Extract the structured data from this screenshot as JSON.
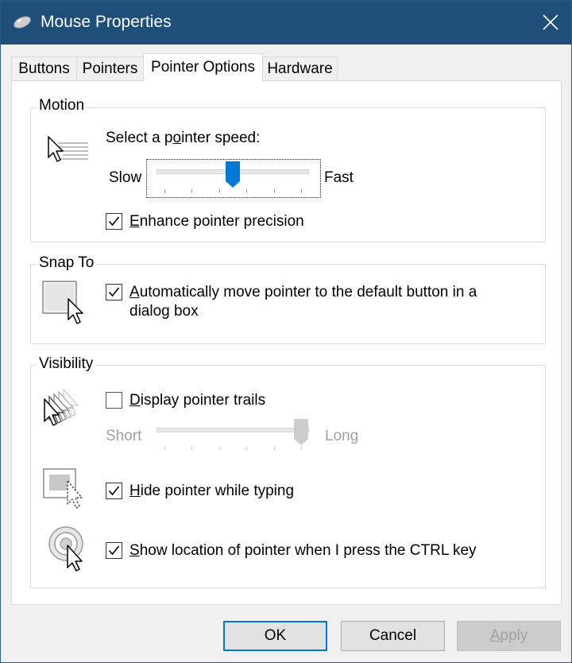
{
  "window": {
    "title": "Mouse Properties"
  },
  "tabs": [
    "Buttons",
    "Pointers",
    "Pointer Options",
    "Hardware"
  ],
  "active_tab_index": 2,
  "motion": {
    "group_label": "Motion",
    "speed_prompt": "Select a pointer speed:",
    "slow_label": "Slow",
    "fast_label": "Fast",
    "speed_value": 0.5,
    "enhance_precision": {
      "label": "Enhance pointer precision",
      "checked": true
    }
  },
  "snap_to": {
    "group_label": "Snap To",
    "auto_move": {
      "line1": "Automatically move pointer to the default button in a",
      "line2": "dialog box",
      "checked": true
    }
  },
  "visibility": {
    "group_label": "Visibility",
    "trails": {
      "label": "Display pointer trails",
      "checked": false,
      "short_label": "Short",
      "long_label": "Long",
      "trail_value": 1.0,
      "enabled": false
    },
    "hide_typing": {
      "label": "Hide pointer while typing",
      "checked": true
    },
    "show_location": {
      "label": "Show location of pointer when I press the CTRL key",
      "checked": true
    }
  },
  "buttons": {
    "ok": "OK",
    "cancel": "Cancel",
    "apply": "Apply"
  },
  "colors": {
    "titlebar": "#1f4e79",
    "accent": "#0078d7"
  }
}
